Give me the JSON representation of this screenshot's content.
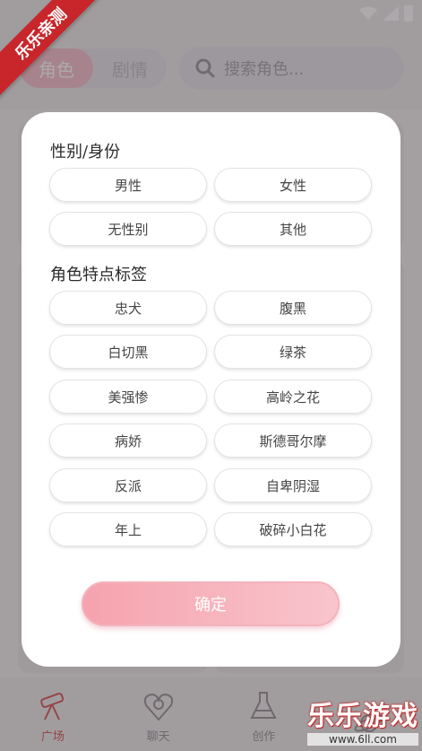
{
  "ribbon": "乐乐亲测",
  "header": {
    "tabs": [
      {
        "label": "角色",
        "active": true
      },
      {
        "label": "剧情",
        "active": false
      }
    ],
    "search_placeholder": "搜索角色..."
  },
  "tabbar": [
    {
      "label": "广场",
      "icon": "telescope-icon",
      "active": true
    },
    {
      "label": "聊天",
      "icon": "spiral-heart-icon",
      "active": false
    },
    {
      "label": "创作",
      "icon": "flask-icon",
      "active": false
    },
    {
      "label": "",
      "icon": "planet-icon",
      "active": false
    }
  ],
  "modal": {
    "section1_title": "性别/身份",
    "gender_options": [
      "男性",
      "女性",
      "无性别",
      "其他"
    ],
    "section2_title": "角色特点标签",
    "trait_tags": [
      "忠犬",
      "腹黑",
      "白切黑",
      "绿茶",
      "美强惨",
      "高岭之花",
      "病娇",
      "斯德哥尔摩",
      "反派",
      "自卑阴湿",
      "年上",
      "破碎小白花"
    ],
    "confirm_label": "确定"
  },
  "watermark": {
    "main": "乐乐游戏",
    "url": "www.6ll.com"
  },
  "colors": {
    "accent_pink": "#f5a3ae",
    "ribbon_red": "#c8262a",
    "active_tab_red": "#d5403f"
  }
}
